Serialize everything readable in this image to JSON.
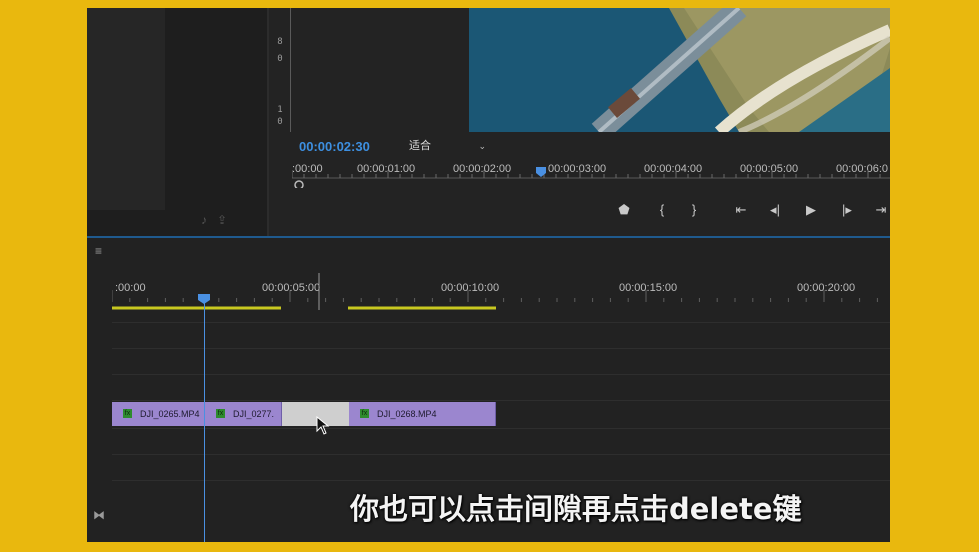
{
  "program_monitor": {
    "timecode": "00:00:02:30",
    "fit_label": "适合",
    "ruler_labels": [
      ":00:00",
      "00:00:01:00",
      "00:00:02:00",
      "00:00:03:00",
      "00:00:04:00",
      "00:00:05:00",
      "00:00:06:0"
    ],
    "meter_labels": [
      "8",
      "0",
      "1",
      "0"
    ],
    "controls": [
      "marker-icon",
      "mark-in-icon",
      "mark-out-icon",
      "go-to-in-icon",
      "step-back-icon",
      "play-icon",
      "step-forward-icon",
      "go-to-out-icon"
    ]
  },
  "timeline": {
    "ruler_labels": [
      ":00:00",
      "00:00:05:00",
      "00:00:10:00",
      "00:00:15:00",
      "00:00:20:00"
    ],
    "clips": [
      {
        "label": "DJI_0265.MP4"
      },
      {
        "label": "DJI_0277."
      },
      {
        "label": "DJI_0268.MP4"
      }
    ],
    "colors": {
      "clip": "#9b86cf",
      "gap_selected": "#cfcfcf",
      "playhead": "#4a90e2",
      "work_area": "#c8c820"
    }
  },
  "subtitle": "你也可以点击间隙再点击delete键"
}
